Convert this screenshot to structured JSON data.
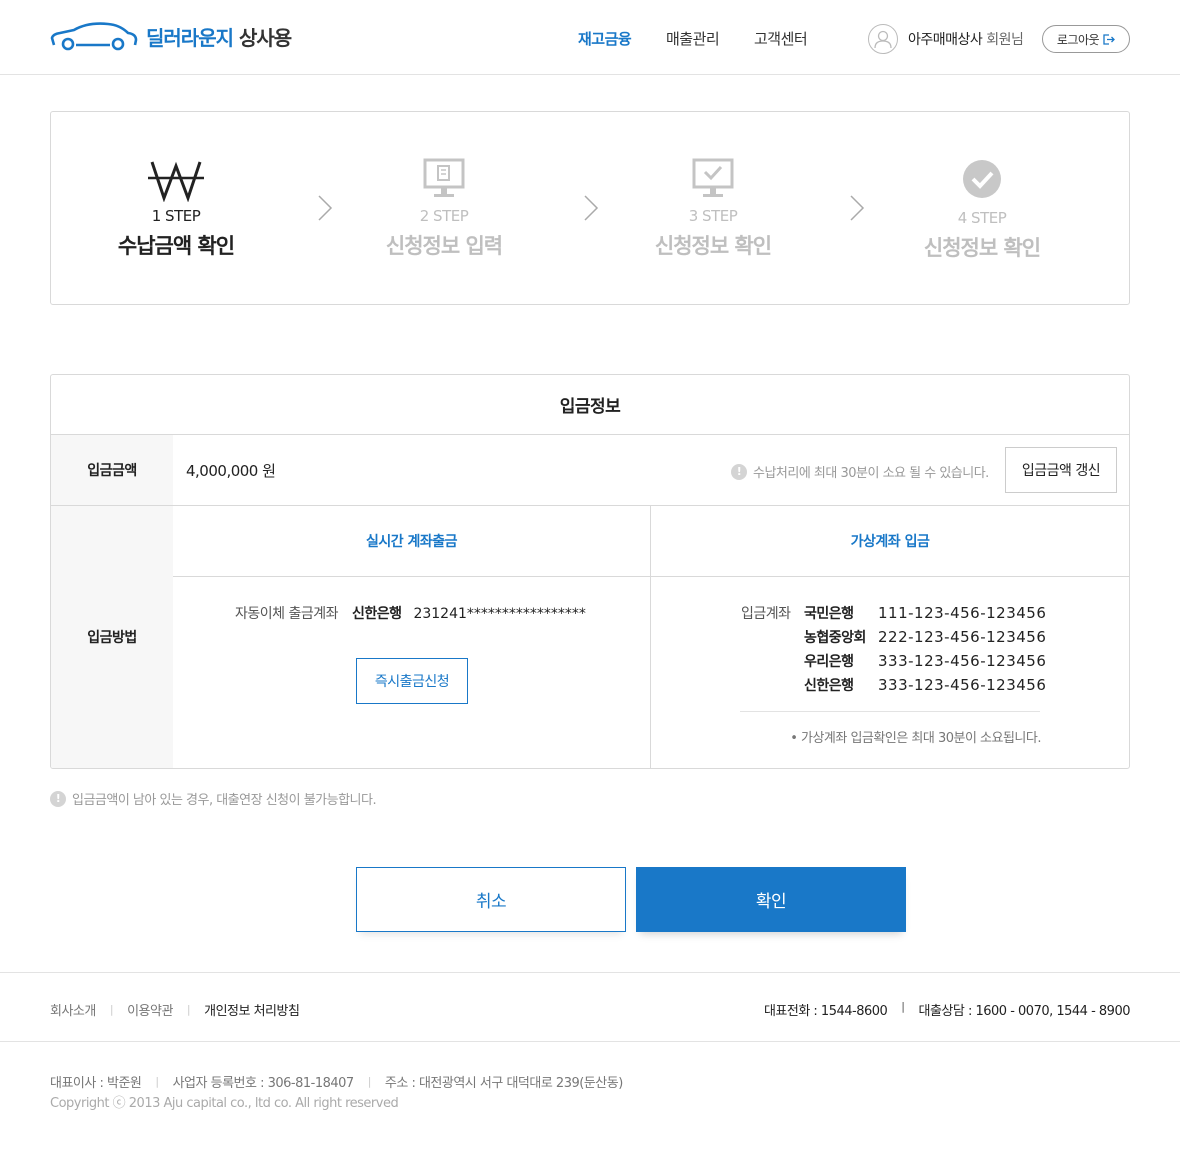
{
  "header": {
    "logo_text": "딜러라운지",
    "logo_sub": "상사용",
    "nav": [
      {
        "label": "재고금융",
        "active": true
      },
      {
        "label": "매출관리",
        "active": false
      },
      {
        "label": "고객센터",
        "active": false
      }
    ],
    "user_name": "아주매매상사",
    "user_suffix": "회원님",
    "logout_label": "로그아웃"
  },
  "steps": [
    {
      "num": "1 STEP",
      "title": "수납금액 확인",
      "icon": "won-icon",
      "active": true
    },
    {
      "num": "2 STEP",
      "title": "신청정보 입력",
      "icon": "monitor-document-icon",
      "active": false
    },
    {
      "num": "3 STEP",
      "title": "신청정보 확인",
      "icon": "monitor-check-icon",
      "active": false
    },
    {
      "num": "4 STEP",
      "title": "신청정보 확인",
      "icon": "check-circle-icon",
      "active": false
    }
  ],
  "deposit": {
    "title": "입금정보",
    "amount_label": "입금금액",
    "amount_value": "4,000,000 원",
    "amount_notice": "수납처리에 최대 30분이 소요 될 수 있습니다.",
    "refresh_label": "입금금액 갱신",
    "method_label": "입금방법",
    "realtime": {
      "heading": "실시간 계좌출금",
      "auto_label": "자동이체 출금계좌",
      "bank": "신한은행",
      "account": "231241*****************",
      "instant_label": "즉시출금신청"
    },
    "virtual": {
      "heading": "가상계좌 입금",
      "account_label": "입금계좌",
      "accounts": [
        {
          "bank": "국민은행",
          "number": "111-123-456-123456"
        },
        {
          "bank": "농협중앙회",
          "number": "222-123-456-123456"
        },
        {
          "bank": "우리은행",
          "number": "333-123-456-123456"
        },
        {
          "bank": "신한은행",
          "number": "333-123-456-123456"
        }
      ],
      "note": "•  가상계좌 입금확인은 최대 30분이 소요됩니다."
    }
  },
  "warning": "입금금액이 남아 있는 경우, 대출연장 신청이 불가능합니다.",
  "actions": {
    "cancel_label": "취소",
    "confirm_label": "확인"
  },
  "footer": {
    "links": [
      {
        "label": "회사소개"
      },
      {
        "label": "이용약관"
      },
      {
        "label": "개인정보 처리방침"
      }
    ],
    "phone": "대표전화 : 1544-8600",
    "loan_contact": "대출상담 : 1600 - 0070, 1544 - 8900",
    "ceo": "대표이사 : 박준원",
    "biz_number": "사업자 등록번호 : 306-81-18407",
    "address": "주소 : 대전광역시 서구 대덕대로 239(둔산동)",
    "copyright": "Copyright ⓒ 2013 Aju capital co., ltd co. All right reserved"
  },
  "colors": {
    "accent": "#1978c8",
    "disabled": "#bfbfbf",
    "border": "#d9d9d9"
  }
}
